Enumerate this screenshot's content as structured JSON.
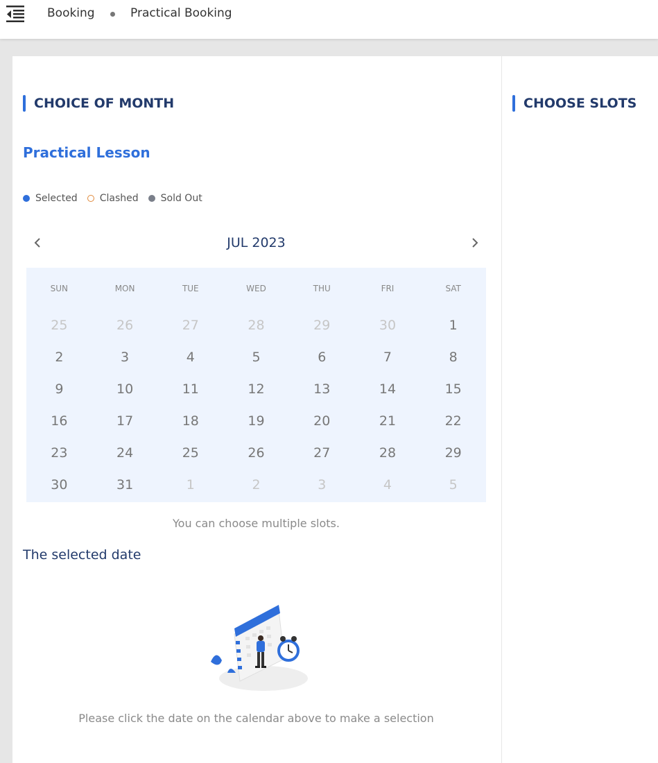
{
  "header": {
    "menu_icon": "menu-collapse-icon",
    "breadcrumb": [
      "Booking",
      "Practical Booking"
    ]
  },
  "left": {
    "section_title": "CHOICE OF MONTH",
    "lesson_title": "Practical Lesson",
    "legend": [
      {
        "label": "Selected",
        "style": "filled",
        "color": "#2f6fdb"
      },
      {
        "label": "Clashed",
        "style": "outline",
        "color": "#e08a3c"
      },
      {
        "label": "Sold Out",
        "style": "filled",
        "color": "#7a7f8a"
      }
    ],
    "calendar": {
      "month_label": "JUL 2023",
      "prev_icon": "chevron-left-icon",
      "next_icon": "chevron-right-icon",
      "weekdays": [
        "SUN",
        "MON",
        "TUE",
        "WED",
        "THU",
        "FRI",
        "SAT"
      ],
      "weeks": [
        [
          {
            "d": "25",
            "m": true
          },
          {
            "d": "26",
            "m": true
          },
          {
            "d": "27",
            "m": true
          },
          {
            "d": "28",
            "m": true
          },
          {
            "d": "29",
            "m": true
          },
          {
            "d": "30",
            "m": true
          },
          {
            "d": "1",
            "m": false
          }
        ],
        [
          {
            "d": "2",
            "m": false
          },
          {
            "d": "3",
            "m": false
          },
          {
            "d": "4",
            "m": false
          },
          {
            "d": "5",
            "m": false
          },
          {
            "d": "6",
            "m": false
          },
          {
            "d": "7",
            "m": false
          },
          {
            "d": "8",
            "m": false
          }
        ],
        [
          {
            "d": "9",
            "m": false
          },
          {
            "d": "10",
            "m": false
          },
          {
            "d": "11",
            "m": false
          },
          {
            "d": "12",
            "m": false
          },
          {
            "d": "13",
            "m": false
          },
          {
            "d": "14",
            "m": false
          },
          {
            "d": "15",
            "m": false
          }
        ],
        [
          {
            "d": "16",
            "m": false
          },
          {
            "d": "17",
            "m": false
          },
          {
            "d": "18",
            "m": false
          },
          {
            "d": "19",
            "m": false
          },
          {
            "d": "20",
            "m": false
          },
          {
            "d": "21",
            "m": false
          },
          {
            "d": "22",
            "m": false
          }
        ],
        [
          {
            "d": "23",
            "m": false
          },
          {
            "d": "24",
            "m": false
          },
          {
            "d": "25",
            "m": false
          },
          {
            "d": "26",
            "m": false
          },
          {
            "d": "27",
            "m": false
          },
          {
            "d": "28",
            "m": false
          },
          {
            "d": "29",
            "m": false
          }
        ],
        [
          {
            "d": "30",
            "m": false
          },
          {
            "d": "31",
            "m": false
          },
          {
            "d": "1",
            "m": true
          },
          {
            "d": "2",
            "m": true
          },
          {
            "d": "3",
            "m": true
          },
          {
            "d": "4",
            "m": true
          },
          {
            "d": "5",
            "m": true
          }
        ]
      ]
    },
    "hint": "You can choose multiple slots.",
    "selected_date_title": "The selected date",
    "illustration_icon": "calendar-person-illustration",
    "empty_message": "Please click the date on the calendar above to make a selection"
  },
  "right": {
    "section_title": "CHOOSE SLOTS"
  }
}
